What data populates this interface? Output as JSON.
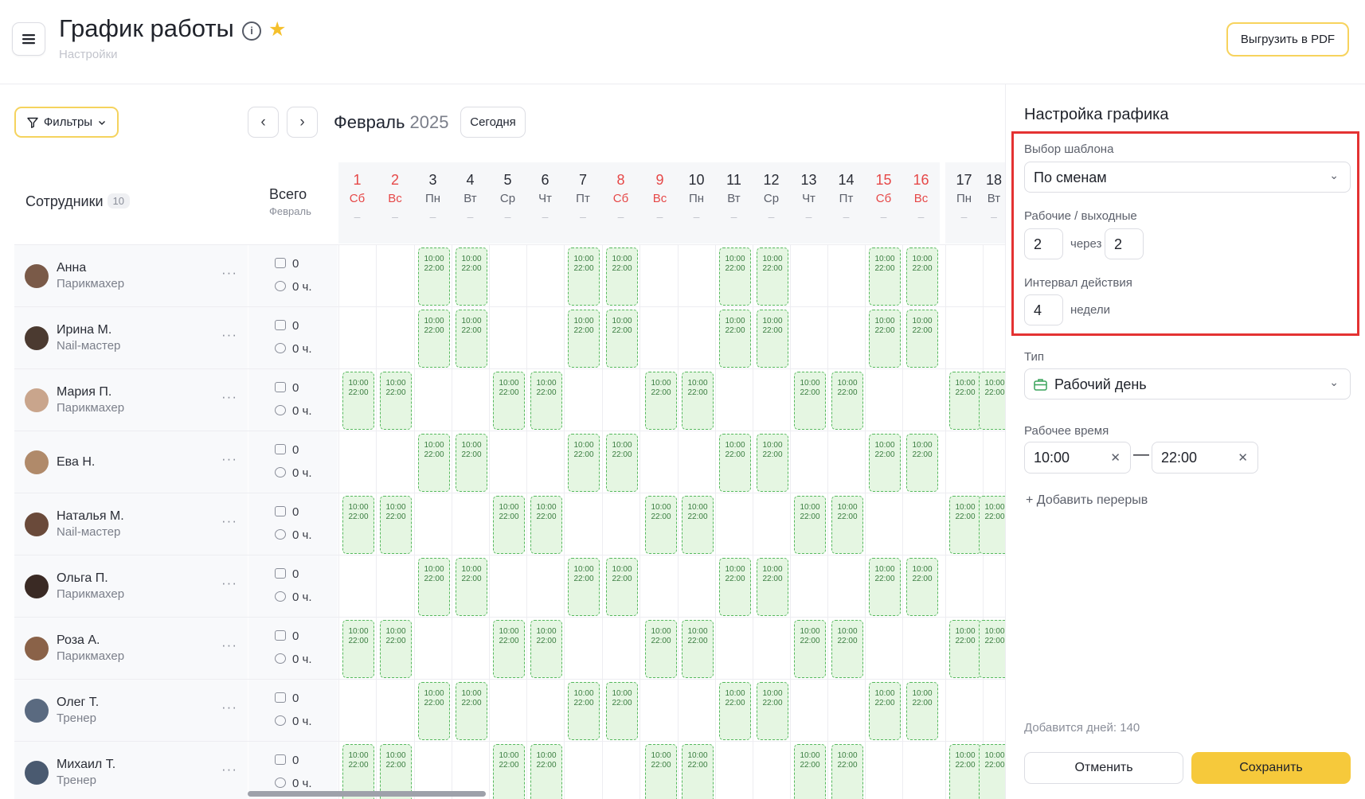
{
  "header": {
    "title": "График работы",
    "breadcrumb": "Настройки",
    "export_label": "Выгрузить в PDF"
  },
  "toolbar": {
    "filters_label": "Фильтры",
    "prev_label": "‹",
    "next_label": "›",
    "month_name": "Февраль",
    "year": "2025",
    "today_label": "Сегодня"
  },
  "grid": {
    "employees_header": "Сотрудники",
    "employees_count": "10",
    "total_header": "Всего",
    "total_sub": "Февраль",
    "days": [
      {
        "num": "1",
        "wd": "Сб",
        "weekend": true
      },
      {
        "num": "2",
        "wd": "Вс",
        "weekend": true
      },
      {
        "num": "3",
        "wd": "Пн",
        "weekend": false
      },
      {
        "num": "4",
        "wd": "Вт",
        "weekend": false
      },
      {
        "num": "5",
        "wd": "Ср",
        "weekend": false
      },
      {
        "num": "6",
        "wd": "Чт",
        "weekend": false
      },
      {
        "num": "7",
        "wd": "Пт",
        "weekend": false
      },
      {
        "num": "8",
        "wd": "Сб",
        "weekend": true
      },
      {
        "num": "9",
        "wd": "Вс",
        "weekend": true
      },
      {
        "num": "10",
        "wd": "Пн",
        "weekend": false
      },
      {
        "num": "11",
        "wd": "Вт",
        "weekend": false
      },
      {
        "num": "12",
        "wd": "Ср",
        "weekend": false
      },
      {
        "num": "13",
        "wd": "Чт",
        "weekend": false
      },
      {
        "num": "14",
        "wd": "Пт",
        "weekend": false
      },
      {
        "num": "15",
        "wd": "Сб",
        "weekend": true
      },
      {
        "num": "16",
        "wd": "Вс",
        "weekend": true
      },
      {
        "num": "17",
        "wd": "Пн",
        "weekend": false
      },
      {
        "num": "18",
        "wd": "Вт",
        "weekend": false
      }
    ],
    "day_dash": "–",
    "shift_start": "10:00",
    "shift_end": "22:00",
    "shift_pattern_a": [
      false,
      false,
      true,
      true,
      false,
      false,
      true,
      true,
      false,
      false,
      true,
      true,
      false,
      false,
      true,
      true,
      false,
      false
    ],
    "shift_pattern_b": [
      true,
      true,
      false,
      false,
      true,
      true,
      false,
      false,
      true,
      true,
      false,
      false,
      true,
      true,
      false,
      false,
      true,
      true
    ],
    "employees": [
      {
        "name": "Анна",
        "role": "Парикмахер",
        "count": "0",
        "hours": "0 ч.",
        "pattern": "a",
        "avatar": "#7a5a48"
      },
      {
        "name": "Ирина М.",
        "role": "Nail-мастер",
        "count": "0",
        "hours": "0 ч.",
        "pattern": "a",
        "avatar": "#4b3a30"
      },
      {
        "name": "Мария П.",
        "role": "Парикмахер",
        "count": "0",
        "hours": "0 ч.",
        "pattern": "b",
        "avatar": "#c9a58c"
      },
      {
        "name": "Ева Н.",
        "role": "",
        "count": "0",
        "hours": "0 ч.",
        "pattern": "a",
        "avatar": "#b08a6a"
      },
      {
        "name": "Наталья М.",
        "role": "Nail-мастер",
        "count": "0",
        "hours": "0 ч.",
        "pattern": "b",
        "avatar": "#6a4a3a"
      },
      {
        "name": "Ольга П.",
        "role": "Парикмахер",
        "count": "0",
        "hours": "0 ч.",
        "pattern": "a",
        "avatar": "#3a2a24"
      },
      {
        "name": "Роза А.",
        "role": "Парикмахер",
        "count": "0",
        "hours": "0 ч.",
        "pattern": "b",
        "avatar": "#8a6248"
      },
      {
        "name": "Олег Т.",
        "role": "Тренер",
        "count": "0",
        "hours": "0 ч.",
        "pattern": "a",
        "avatar": "#5a6a80"
      },
      {
        "name": "Михаил Т.",
        "role": "Тренер",
        "count": "0",
        "hours": "0 ч.",
        "pattern": "b",
        "avatar": "#4a5a70"
      }
    ]
  },
  "panel": {
    "title": "Настройка графика",
    "template_label": "Выбор шаблона",
    "template_value": "По сменам",
    "workdays_label": "Рабочие / выходные",
    "work_days": "2",
    "through_label": "через",
    "off_days": "2",
    "interval_label": "Интервал действия",
    "interval_value": "4",
    "interval_unit": "недели",
    "type_label": "Тип",
    "type_value": "Рабочий день",
    "work_time_label": "Рабочее время",
    "time_from": "10:00",
    "time_to": "22:00",
    "time_dash": "—",
    "add_break_label": "Добавить перерыв",
    "added_days": "Добавится дней: 140",
    "cancel_label": "Отменить",
    "save_label": "Сохранить"
  }
}
